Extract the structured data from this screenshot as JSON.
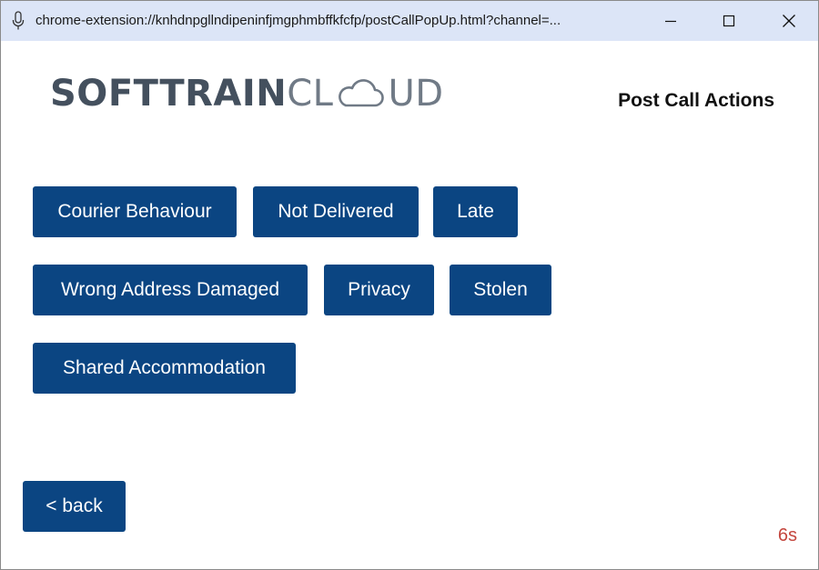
{
  "window": {
    "title_url": "chrome-extension://knhdnpgllndipeninfjmgphmbffkfcfp/postCallPopUp.html?channel=...",
    "controls": {
      "minimize_icon": "minimize-icon",
      "maximize_icon": "maximize-icon",
      "close_icon": "close-icon"
    }
  },
  "header": {
    "logo_bold": "SOFTTRAIN",
    "logo_light_1": "CL",
    "logo_light_2": "UD",
    "title": "Post Call Actions"
  },
  "actions": [
    {
      "label": "Courier Behaviour"
    },
    {
      "label": "Not Delivered"
    },
    {
      "label": "Late"
    },
    {
      "label": "Wrong Address Damaged"
    },
    {
      "label": "Privacy"
    },
    {
      "label": "Stolen"
    },
    {
      "label": "Shared Accommodation"
    }
  ],
  "footer": {
    "back_label": "< back",
    "timer": "6s"
  },
  "colors": {
    "button_bg": "#0b4582",
    "titlebar_bg": "#dce5f7",
    "timer_text": "#c4463e"
  }
}
